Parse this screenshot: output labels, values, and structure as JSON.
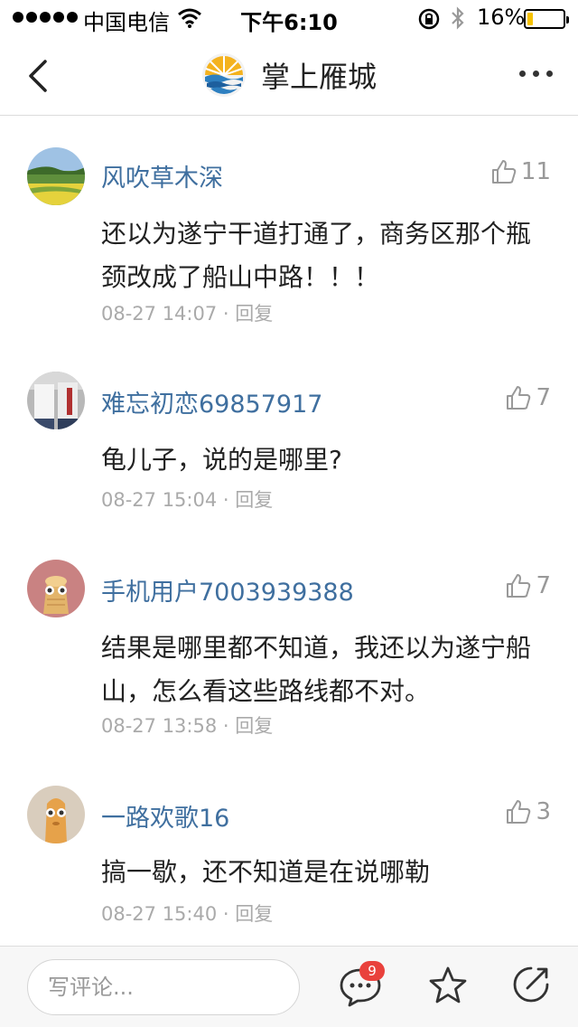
{
  "status_bar": {
    "carrier": "中国电信",
    "time": "下午6:10",
    "battery_percent": "16%",
    "battery_level": 0.16,
    "battery_color": "#f6c200"
  },
  "nav": {
    "title": "掌上雁城",
    "back_icon": "chevron-left-icon",
    "more_icon": "more-horizontal-icon"
  },
  "comments": [
    {
      "username": "风吹草木深",
      "likes": "11",
      "content": "还以为遂宁干道打通了，商务区那个瓶颈改成了船山中路！！！",
      "date": "08-27 14:07",
      "reply": "· 回复"
    },
    {
      "username": "难忘初恋69857917",
      "likes": "7",
      "content": "龟儿子，说的是哪里?",
      "date": "08-27 15:04",
      "reply": "· 回复"
    },
    {
      "username": "手机用户7003939388",
      "likes": "7",
      "content": "结果是哪里都不知道，我还以为遂宁船山，怎么看这些路线都不对。",
      "date": "08-27 13:58",
      "reply": "· 回复"
    },
    {
      "username": "一路欢歌16",
      "likes": "3",
      "content": "搞一歇，还不知道是在说哪勒",
      "date": "08-27 15:40",
      "reply": "· 回复"
    }
  ],
  "bottom_bar": {
    "input_placeholder": "写评论...",
    "comment_count_badge": "9",
    "badge_color": "#e9413c"
  }
}
